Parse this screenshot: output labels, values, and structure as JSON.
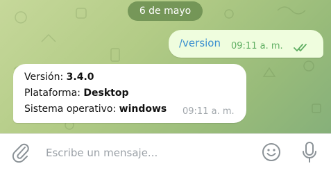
{
  "date_separator": "6 de mayo",
  "outgoing": {
    "text": "/version",
    "time": "09:11 a. m.",
    "status_icon": "double-check-icon"
  },
  "incoming": {
    "line1_label": "Versión: ",
    "line1_value": "3.4.0",
    "line2_label": "Plataforma: ",
    "line2_value": "Desktop",
    "line3_label": "Sistema operativo: ",
    "line3_value": "windows",
    "time": "09:11 a. m."
  },
  "composer": {
    "placeholder": "Escribe un mensaje...",
    "attach_icon": "paperclip-icon",
    "emoji_icon": "emoji-icon",
    "mic_icon": "microphone-icon"
  },
  "colors": {
    "accent_link": "#3a8fd0",
    "outgoing_time": "#5fae62",
    "outgoing_bubble": "#effdde"
  }
}
